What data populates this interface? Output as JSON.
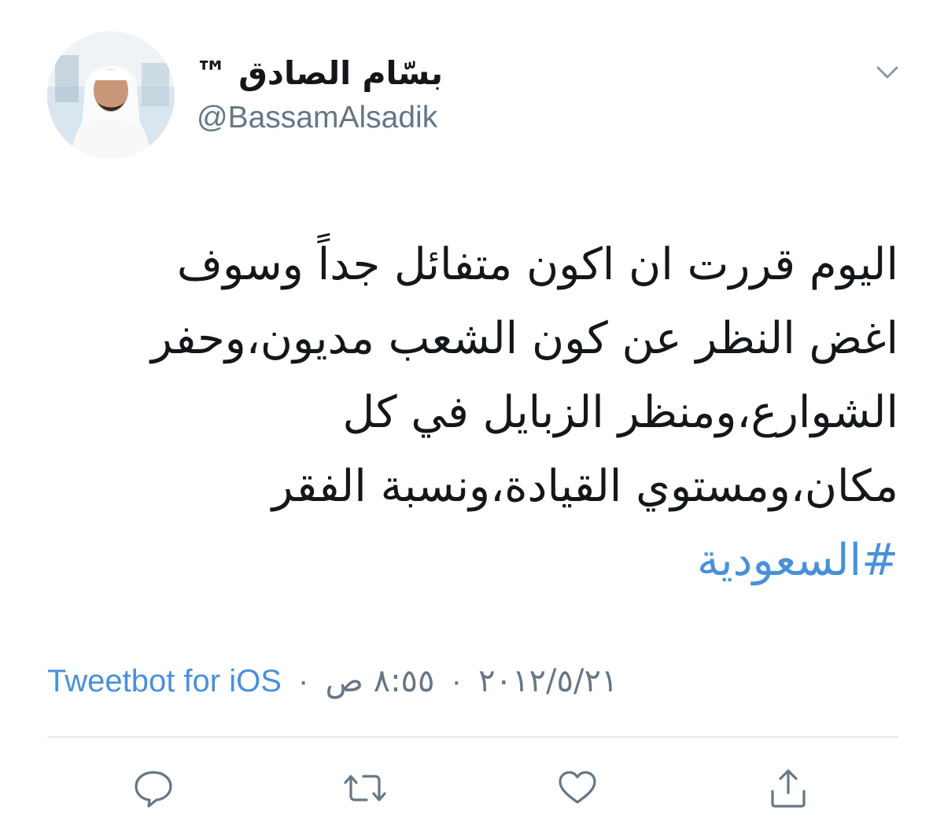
{
  "author": {
    "display_name": "بسّام الصادق ™",
    "handle": "@BassamAlsadik"
  },
  "tweet": {
    "lines": [
      "اليوم قررت ان اكون متفائل جداً وسوف",
      "اغض النظر عن كون الشعب مديون،وحفر",
      "الشوارع،ومنظر الزبايل في كل",
      "مكان،ومستوي القيادة،ونسبة الفقر"
    ],
    "hashtag": "#السعودية"
  },
  "meta": {
    "time": "٨:٥٥ ص",
    "date": "٢٠١٢/٥/٢١",
    "separator": "·",
    "source": "Tweetbot for iOS"
  },
  "icons": {
    "menu": "chevron-down-icon",
    "reply": "reply-icon",
    "retweet": "retweet-icon",
    "like": "heart-icon",
    "share": "share-icon"
  },
  "colors": {
    "link": "#4a90d9",
    "secondary_text": "#657786",
    "icon": "#657786",
    "divider": "#e1e8ed"
  }
}
